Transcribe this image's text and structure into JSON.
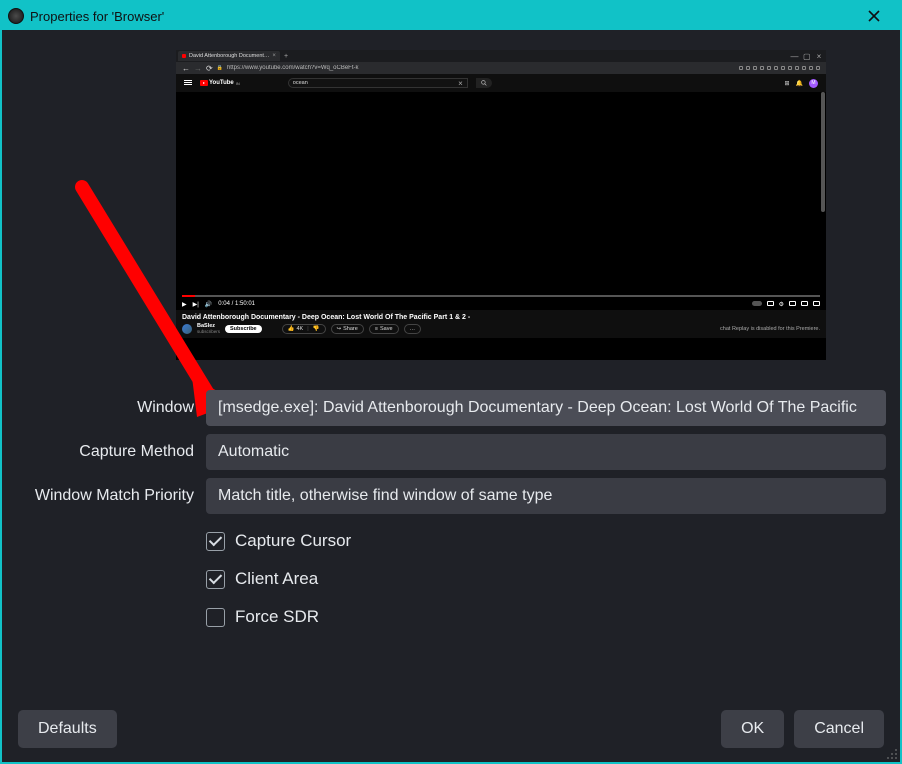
{
  "window": {
    "title": "Properties for 'Browser'"
  },
  "preview": {
    "tab_label": "David Attenborough Document…",
    "url": "https://www.youtube.com/watch?v=Wq_oCBeFt-k",
    "youtube_brand": "YouTube",
    "youtube_brand_suffix": "IN",
    "search_placeholder": "ocean",
    "search_close": "×",
    "avatar_letter": "M",
    "play_time": "0:04 / 1:50:01",
    "video_title": "David Attenborough Documentary - Deep Ocean: Lost World Of The Pacific Part 1 & 2 -",
    "channel_name": "BaSlez",
    "channel_sub_line": "subscribers",
    "subscribe_label": "Subscribe",
    "like_count": "4K",
    "share_label": "Share",
    "save_label": "Save",
    "more_label": "…",
    "replay_message": "chat Replay is disabled for this Premiere."
  },
  "form": {
    "window_label": "Window",
    "window_value": "[msedge.exe]: David Attenborough Documentary - Deep Ocean: Lost World Of The Pacific",
    "capture_method_label": "Capture Method",
    "capture_method_value": "Automatic",
    "match_priority_label": "Window Match Priority",
    "match_priority_value": "Match title, otherwise find window of same type",
    "capture_cursor_label": "Capture Cursor",
    "capture_cursor_checked": true,
    "client_area_label": "Client Area",
    "client_area_checked": true,
    "force_sdr_label": "Force SDR",
    "force_sdr_checked": false
  },
  "footer": {
    "defaults": "Defaults",
    "ok": "OK",
    "cancel": "Cancel"
  },
  "colors": {
    "accent": "#11c2c7",
    "arrow": "#ff0000"
  }
}
